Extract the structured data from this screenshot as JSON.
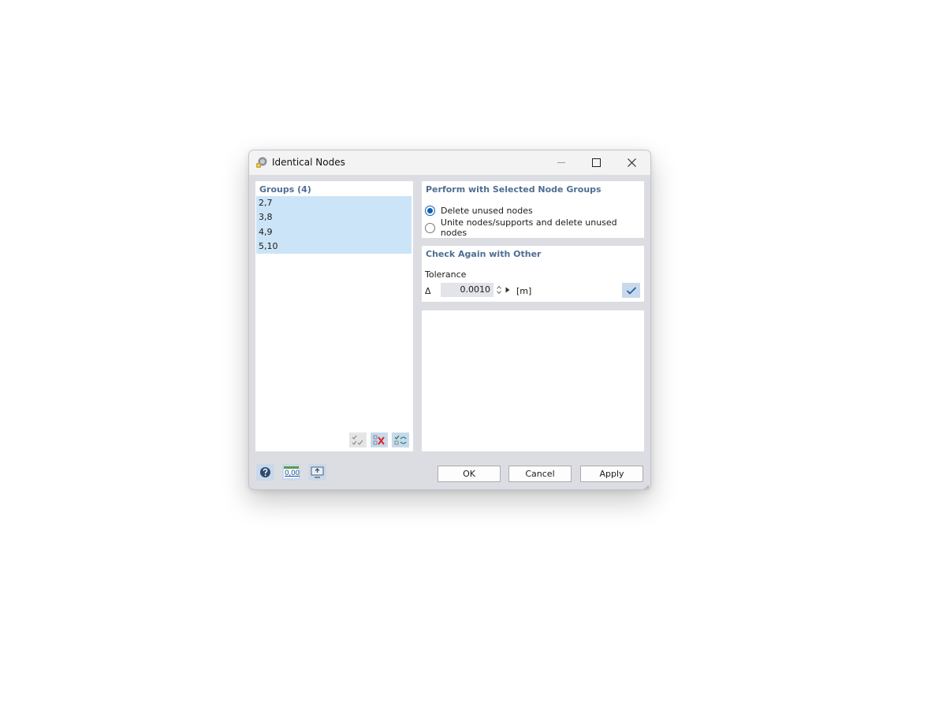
{
  "window": {
    "title": "Identical Nodes",
    "controls": {
      "minimize": "—",
      "maximize": "☐",
      "close": "✕"
    }
  },
  "groups": {
    "header": "Groups (4)",
    "items": [
      "2,7",
      "3,8",
      "4,9",
      "5,10"
    ],
    "toolbar_icons": [
      "select-all-icon",
      "delete-selection-icon",
      "invert-selection-icon"
    ]
  },
  "perform": {
    "header": "Perform with Selected Node Groups",
    "options": [
      {
        "label": "Delete unused nodes",
        "checked": true
      },
      {
        "label": "Unite nodes/supports and delete unused nodes",
        "checked": false
      }
    ]
  },
  "check_again": {
    "header": "Check Again with Other",
    "tolerance_label": "Tolerance",
    "delta_symbol": "Δ",
    "tolerance_value": "0.0010",
    "unit": "[m]",
    "check_icon": "checkmark-icon"
  },
  "footer": {
    "icons": [
      "help-icon",
      "number-format-icon",
      "display-settings-icon"
    ],
    "number_icon_text": "0,00",
    "ok": "OK",
    "cancel": "Cancel",
    "apply": "Apply"
  },
  "colors": {
    "accent": "#0f5fb5",
    "header_text": "#4f6e92",
    "selection": "#cce4f7",
    "dialog_bg": "#dcdde2"
  }
}
